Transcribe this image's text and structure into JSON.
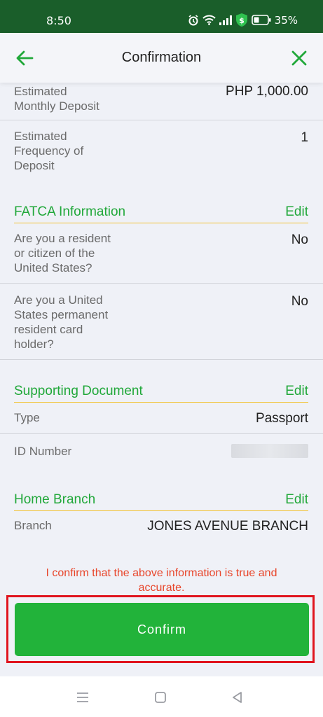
{
  "status_bar": {
    "time": "8:50",
    "battery": "35%"
  },
  "header": {
    "title": "Confirmation"
  },
  "rows": {
    "monthly_deposit": {
      "label_line1": "Estimated",
      "label_line2": "Monthly Deposit",
      "value": "PHP 1,000.00"
    },
    "frequency": {
      "label_line1": "Estimated",
      "label_line2": "Frequency of",
      "label_line3": "Deposit",
      "value": "1"
    }
  },
  "fatca": {
    "title": "FATCA Information",
    "edit": "Edit",
    "q1": {
      "line1": "Are you a resident",
      "line2": "or citizen of the",
      "line3": "United States?",
      "value": "No"
    },
    "q2": {
      "line1": "Are you a United",
      "line2": "States permanent",
      "line3": "resident card",
      "line4": "holder?",
      "value": "No"
    }
  },
  "supporting_document": {
    "title": "Supporting Document",
    "edit": "Edit",
    "type_label": "Type",
    "type_value": "Passport",
    "id_label": "ID Number"
  },
  "home_branch": {
    "title": "Home Branch",
    "edit": "Edit",
    "branch_label": "Branch",
    "branch_value": "JONES AVENUE BRANCH"
  },
  "confirmation": {
    "statement_line1": "I confirm that the above information is true and",
    "statement_line2": "accurate.",
    "button": "Confirm"
  },
  "colors": {
    "accent_green": "#21a83a",
    "button_green": "#22b33a",
    "status_bar": "#1a5e2a",
    "warning_red": "#e8452a",
    "highlight_outline": "#e0141e",
    "section_underline": "#f2c230"
  },
  "icons": {
    "back": "arrow-left-icon",
    "close": "close-icon",
    "alarm": "alarm-icon",
    "wifi": "wifi-icon",
    "signal": "signal-icon",
    "shield": "shield-dollar-icon",
    "battery": "battery-icon",
    "nav_menu": "menu-icon",
    "nav_home": "home-square-icon",
    "nav_back": "back-triangle-icon"
  }
}
